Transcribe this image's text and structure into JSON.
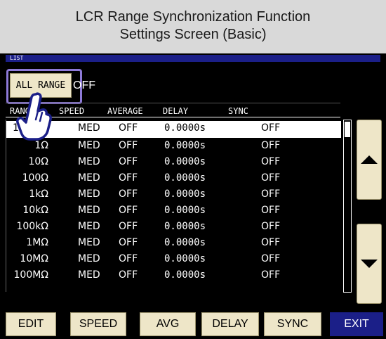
{
  "title": {
    "line1": "LCR Range Synchronization Function",
    "line2": "Settings Screen (Basic)"
  },
  "topbar": {
    "label": "LIST"
  },
  "all_range": {
    "button_label": "ALL RANGE",
    "value": "OFF"
  },
  "columns": [
    "RANGE",
    "SPEED",
    "AVERAGE",
    "DELAY",
    "SYNC"
  ],
  "rows": [
    {
      "range": "100mΩ",
      "speed": "MED",
      "avg": "OFF",
      "delay": "0.0000s",
      "sync": "OFF"
    },
    {
      "range": "1Ω",
      "speed": "MED",
      "avg": "OFF",
      "delay": "0.0000s",
      "sync": "OFF"
    },
    {
      "range": "10Ω",
      "speed": "MED",
      "avg": "OFF",
      "delay": "0.0000s",
      "sync": "OFF"
    },
    {
      "range": "100Ω",
      "speed": "MED",
      "avg": "OFF",
      "delay": "0.0000s",
      "sync": "OFF"
    },
    {
      "range": "1kΩ",
      "speed": "MED",
      "avg": "OFF",
      "delay": "0.0000s",
      "sync": "OFF"
    },
    {
      "range": "10kΩ",
      "speed": "MED",
      "avg": "OFF",
      "delay": "0.0000s",
      "sync": "OFF"
    },
    {
      "range": "100kΩ",
      "speed": "MED",
      "avg": "OFF",
      "delay": "0.0000s",
      "sync": "OFF"
    },
    {
      "range": "1MΩ",
      "speed": "MED",
      "avg": "OFF",
      "delay": "0.0000s",
      "sync": "OFF"
    },
    {
      "range": "10MΩ",
      "speed": "MED",
      "avg": "OFF",
      "delay": "0.0000s",
      "sync": "OFF"
    },
    {
      "range": "100MΩ",
      "speed": "MED",
      "avg": "OFF",
      "delay": "0.0000s",
      "sync": "OFF"
    }
  ],
  "footer": {
    "edit": "EDIT",
    "speed": "SPEED",
    "avg": "AVG",
    "delay": "DELAY",
    "sync": "SYNC",
    "exit": "EXIT"
  },
  "icons": {
    "scroll_up": "triangle-up-icon",
    "scroll_down": "triangle-down-icon",
    "pointer": "pointing-hand-icon"
  },
  "colors": {
    "panel_blue": "#1b1f88",
    "button_beige": "#eee6c8",
    "highlight_purple": "#8e7ad8"
  }
}
